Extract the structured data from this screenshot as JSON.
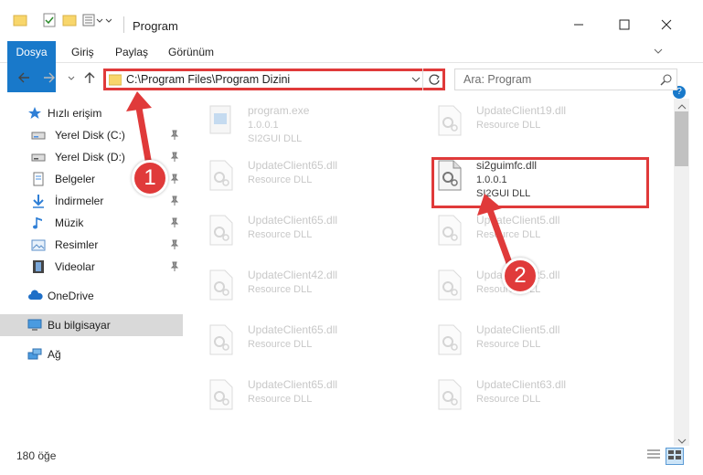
{
  "window": {
    "title": "Program"
  },
  "ribbon": {
    "tabs": [
      "Dosya",
      "Giriş",
      "Paylaş",
      "Görünüm"
    ]
  },
  "address": {
    "path": "C:\\Program Files\\Program Dizini"
  },
  "search": {
    "placeholder": "Ara: Program"
  },
  "sidebar": {
    "quick_access": "Hızlı erişim",
    "items": [
      {
        "label": "Yerel Disk (C:)"
      },
      {
        "label": "Yerel Disk (D:)"
      },
      {
        "label": "Belgeler"
      },
      {
        "label": "İndirmeler"
      },
      {
        "label": "Müzik"
      },
      {
        "label": "Resimler"
      },
      {
        "label": "Videolar"
      }
    ],
    "onedrive": "OneDrive",
    "this_pc": "Bu bilgisayar",
    "network": "Ağ"
  },
  "files": [
    {
      "name": "program.exe",
      "ver": "1.0.0.1",
      "desc": "SI2GUI DLL"
    },
    {
      "name": "UpdateClient19.dll",
      "ver": "Resource DLL",
      "desc": ""
    },
    {
      "name": "UpdateClient65.dll",
      "ver": "Resource DLL",
      "desc": ""
    },
    {
      "name": "si2guimfc.dll",
      "ver": "1.0.0.1",
      "desc": "SI2GUI DLL"
    },
    {
      "name": "UpdateClient65.dll",
      "ver": "Resource DLL",
      "desc": ""
    },
    {
      "name": "UpdateClient5.dll",
      "ver": "Resource DLL",
      "desc": ""
    },
    {
      "name": "UpdateClient42.dll",
      "ver": "Resource DLL",
      "desc": ""
    },
    {
      "name": "UpdateClient5.dll",
      "ver": "Resource DLL",
      "desc": ""
    },
    {
      "name": "UpdateClient65.dll",
      "ver": "Resource DLL",
      "desc": ""
    },
    {
      "name": "UpdateClient5.dll",
      "ver": "Resource DLL",
      "desc": ""
    },
    {
      "name": "UpdateClient65.dll",
      "ver": "Resource DLL",
      "desc": ""
    },
    {
      "name": "UpdateClient63.dll",
      "ver": "Resource DLL",
      "desc": ""
    }
  ],
  "status": {
    "count": "180 öğe"
  },
  "callouts": {
    "one": "1",
    "two": "2"
  },
  "colors": {
    "accent": "#1979ca",
    "highlight": "#e03a3a"
  }
}
